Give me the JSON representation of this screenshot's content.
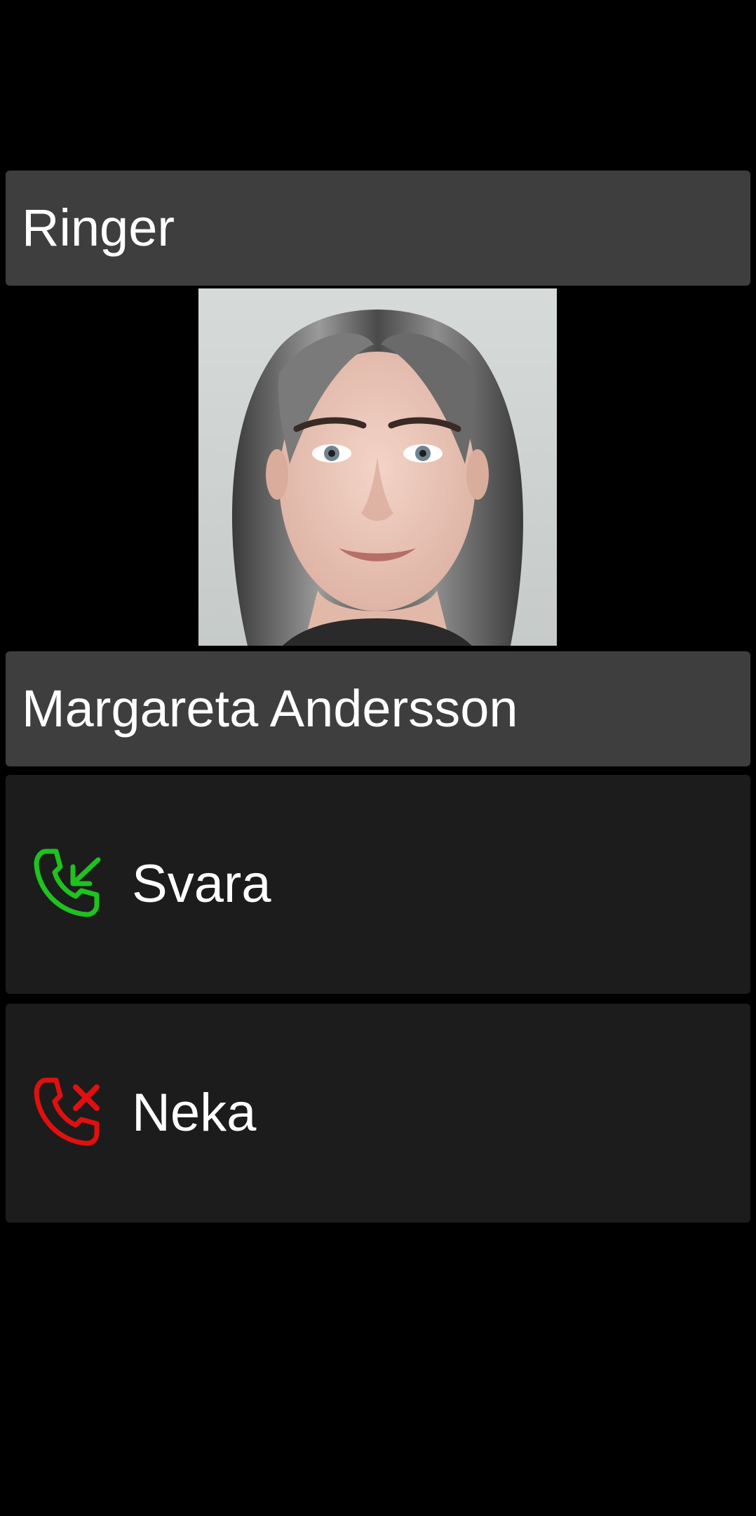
{
  "call": {
    "status_title": "Ringer",
    "caller_name": "Margareta Andersson"
  },
  "actions": {
    "answer": {
      "label": "Svara",
      "icon": "phone-incoming-icon",
      "color": "#1fc21f"
    },
    "decline": {
      "label": "Neka",
      "icon": "phone-decline-icon",
      "color": "#e01010"
    }
  },
  "colors": {
    "background": "#000000",
    "bar": "#3e3e3e",
    "button": "#1c1c1c",
    "text": "#ffffff"
  }
}
